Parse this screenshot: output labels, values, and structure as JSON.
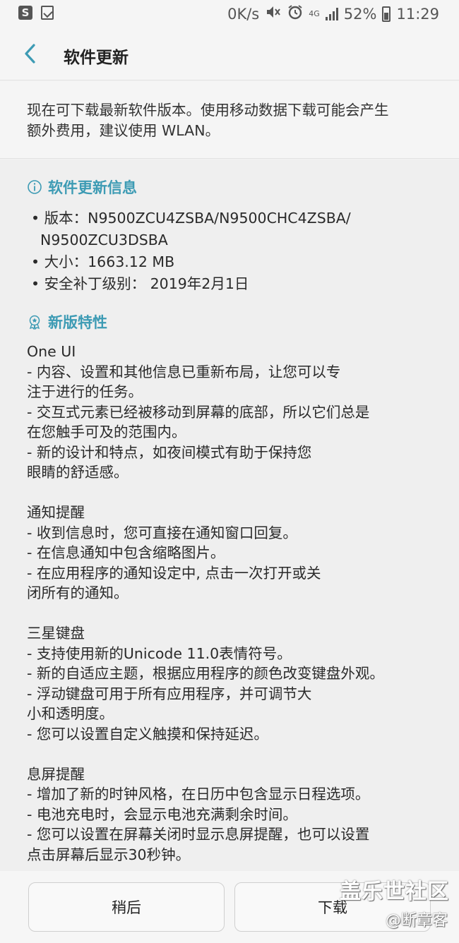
{
  "status_bar": {
    "speed": "0K/s",
    "network": "4G",
    "battery": "52%",
    "time": "11:29",
    "icons": [
      "s-app-icon",
      "check-task-icon",
      "mute-icon",
      "alarm-icon",
      "signal-icon",
      "battery-icon"
    ]
  },
  "header": {
    "title": "软件更新",
    "back_icon": "chevron-left-icon"
  },
  "notice": {
    "text_line1": "现在可下载最新软件版本。使用移动数据下载可能会产生",
    "text_line2": "额外费用，建议使用 WLAN。"
  },
  "info_section": {
    "title": "软件更新信息",
    "icon": "info-circle-icon",
    "rows": [
      "• 版本：N9500ZCU4ZSBA/N9500CHC4ZSBA/",
      "  N9500ZCU3DSBA",
      "• 大小：1663.12 MB",
      "• 安全补丁级别： 2019年2月1日"
    ]
  },
  "features_section": {
    "title": "新版特性",
    "icon": "award-badge-icon",
    "lines": [
      "One UI",
      "- 内容、设置和其他信息已重新布局，让您可以专",
      "注于进行的任务。",
      "- 交互式元素已经被移动到屏幕的底部，所以它们总是",
      "在您触手可及的范围内。",
      "- 新的设计和特点，如夜间模式有助于保持您",
      "眼睛的舒适感。",
      "",
      "通知提醒",
      "- 收到信息时，您可直接在通知窗口回复。",
      "- 在信息通知中包含缩略图片。",
      "- 在应用程序的通知设定中, 点击一次打开或关",
      "闭所有的通知。",
      "",
      "三星键盘",
      "- 支持使用新的Unicode 11.0表情符号。",
      "- 新的自适应主题，根据应用程序的颜色改变键盘外观。",
      "- 浮动键盘可用于所有应用程序，并可调节大",
      "小和透明度。",
      "- 您可以设置自定义触摸和保持延迟。",
      "",
      "息屏提醒",
      "- 增加了新的时钟风格，在日历中包含显示日程选项。",
      "- 电池充电时，会显示电池充满剩余时间。",
      "- 您可以设置在屏幕关闭时显示息屏提醒，也可以设置",
      "点击屏幕后显示30秒钟。"
    ]
  },
  "buttons": {
    "later": "稍后",
    "download": "下载"
  },
  "watermark": {
    "line1": "盖乐世社区",
    "line2": "@断章客"
  },
  "colors": {
    "accent": "#3d9bb4",
    "background": "#efefef"
  }
}
